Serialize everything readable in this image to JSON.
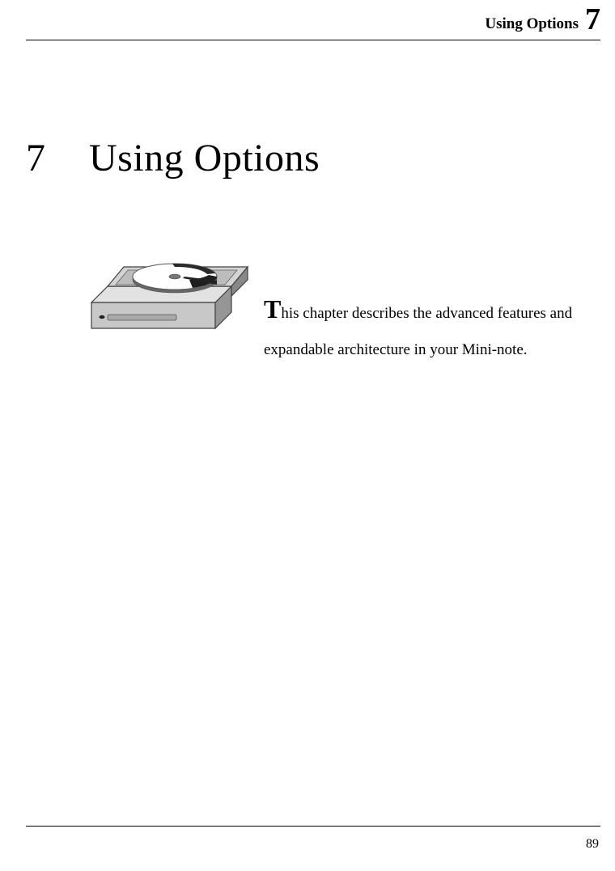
{
  "header": {
    "running_head": "Using Options",
    "chapter_number": "7"
  },
  "heading": {
    "number": "7",
    "title": "Using Options"
  },
  "intro": {
    "dropcap": "T",
    "text": "his chapter describes the advanced features and expandable architecture in your Mini-note."
  },
  "footer": {
    "page_number": "89"
  }
}
